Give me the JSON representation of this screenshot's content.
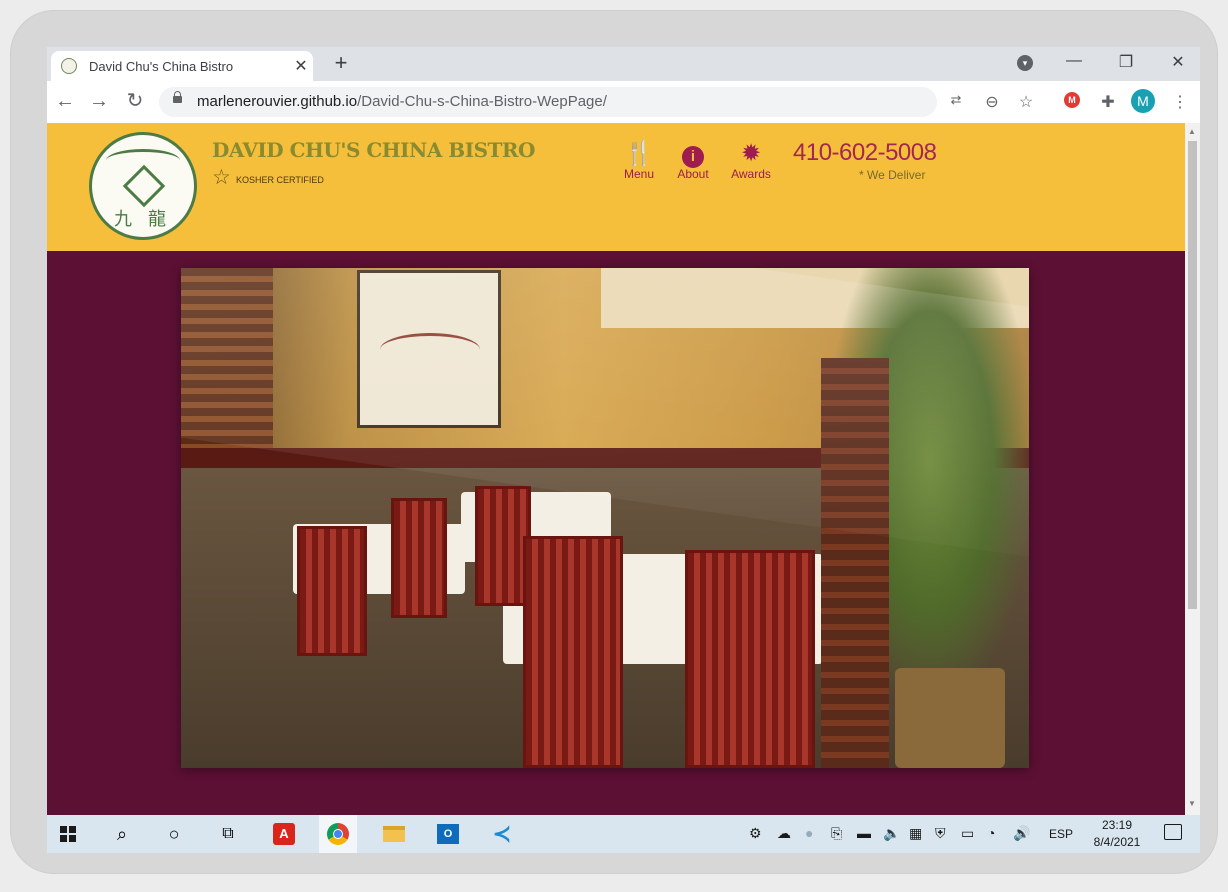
{
  "browser": {
    "tab": {
      "title": "David Chu's China Bistro",
      "close": "✕"
    },
    "new_tab": "+",
    "window_controls": {
      "minimize": "—",
      "restore": "❐",
      "close": "✕"
    },
    "address": {
      "host": "marlenerouvier.github.io",
      "path": "/David-Chu-s-China-Bistro-WepPage/"
    },
    "profile_initial": "M",
    "extension_badge": "M"
  },
  "site": {
    "brand": "DAVID CHU'S CHINA BISTRO",
    "kosher": "KOSHER CERTIFIED",
    "logo_chars": [
      "九",
      "龍"
    ],
    "nav": [
      {
        "label": "Menu",
        "icon": "utensils-icon"
      },
      {
        "label": "About",
        "icon": "info-icon"
      },
      {
        "label": "Awards",
        "icon": "certificate-icon"
      }
    ],
    "phone": "410-602-5008",
    "deliver": "* We Deliver",
    "colors": {
      "header": "#f5bf3c",
      "body": "#5c1034",
      "accent": "#9e1c4f"
    }
  },
  "taskbar": {
    "language": "ESP",
    "time": "23:19",
    "date": "8/4/2021"
  }
}
